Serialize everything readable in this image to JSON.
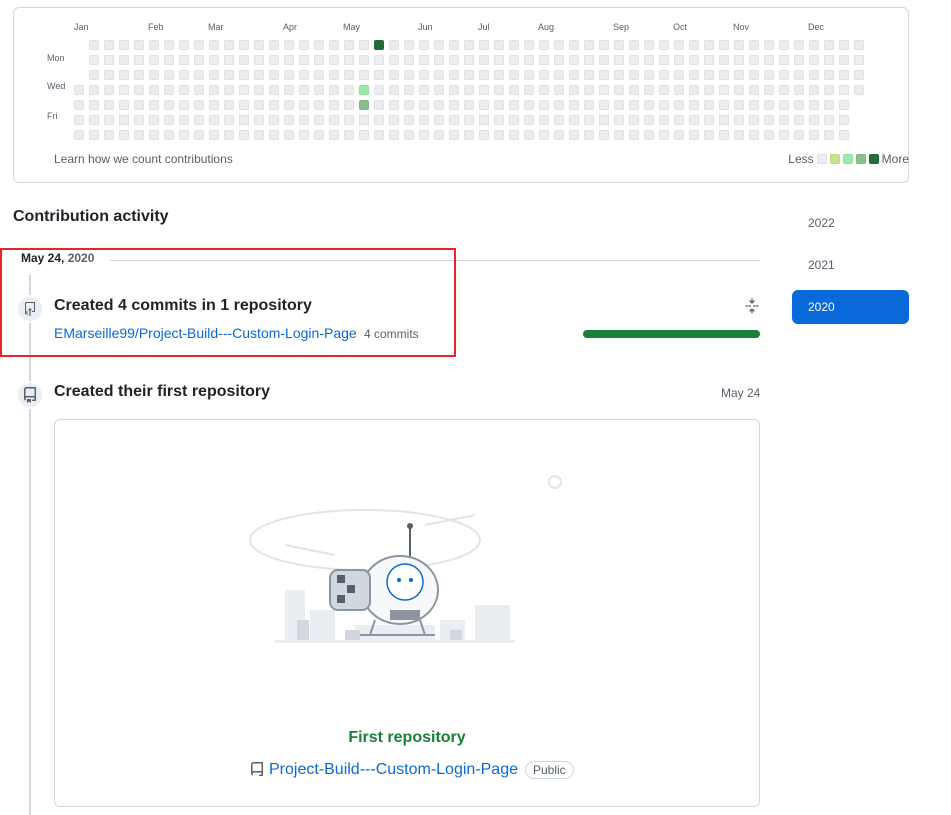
{
  "calendar": {
    "months": [
      "Jan",
      "Feb",
      "Mar",
      "Apr",
      "May",
      "Jun",
      "Jul",
      "Aug",
      "Sep",
      "Oct",
      "Nov",
      "Dec"
    ],
    "day_labels": [
      "Mon",
      "Wed",
      "Fri"
    ],
    "learn_link": "Learn how we count contributions",
    "legend_less": "Less",
    "legend_more": "More",
    "level_colors": [
      "#ebedf0",
      "#c6e48b",
      "#9be9a8",
      "#8cbf90",
      "#216e39"
    ],
    "active_cells": [
      {
        "week": 20,
        "day": 0,
        "level": 4
      },
      {
        "week": 19,
        "day": 3,
        "level": 2
      },
      {
        "week": 19,
        "day": 4,
        "level": 3
      }
    ]
  },
  "activity": {
    "title": "Contribution activity",
    "years": [
      "2022",
      "2021",
      "2020"
    ],
    "selected_year": "2020",
    "date_label": "May 24,",
    "date_year": "2020",
    "commits_entry": {
      "title": "Created 4 commits in 1 repository",
      "repo": "EMarseille99/Project-Build---Custom-Login-Page",
      "count": "4 commits",
      "bar_fraction": 1.0
    },
    "repo_entry": {
      "title": "Created their first repository",
      "date": "May 24",
      "card_title": "First repository",
      "repo_name": "Project-Build---Custom-Login-Page",
      "visibility": "Public"
    }
  }
}
